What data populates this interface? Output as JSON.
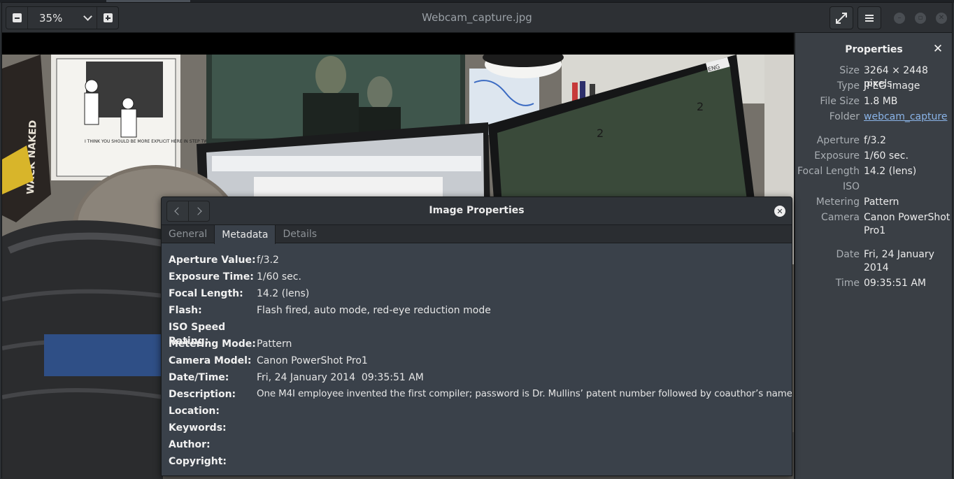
{
  "toolbar": {
    "zoom_value": "35%",
    "zoom_out_icon": "zoom-out-icon",
    "zoom_in_icon": "zoom-in-icon",
    "title": "Webcam_capture.jpg",
    "fullscreen_icon": "fullscreen-icon",
    "menu_icon": "hamburger-menu-icon"
  },
  "sidebar": {
    "title": "Properties",
    "close_icon": "close-icon",
    "rows": [
      {
        "key": "Size",
        "value": "3264 × 2448 pixels"
      },
      {
        "key": "Type",
        "value": "JPEG image"
      },
      {
        "key": "File Size",
        "value": "1.8 MB"
      },
      {
        "key": "Folder",
        "value": "webcam_capture"
      },
      {
        "key": "Aperture",
        "value": "f/3.2"
      },
      {
        "key": "Exposure",
        "value": "1/60 sec."
      },
      {
        "key": "Focal Length",
        "value": "14.2 (lens)"
      },
      {
        "key": "ISO",
        "value": ""
      },
      {
        "key": "Metering",
        "value": "Pattern"
      },
      {
        "key": "Camera",
        "value": "Canon PowerShot Pro1"
      },
      {
        "key": "Date",
        "value": "Fri, 24 January 2014"
      },
      {
        "key": "Time",
        "value": "09:35:51 AM"
      }
    ]
  },
  "dialog": {
    "title": "Image Properties",
    "tabs": [
      "General",
      "Metadata",
      "Details"
    ],
    "active_tab": "Metadata",
    "rows": [
      {
        "key": "Aperture Value:",
        "value": "f/3.2"
      },
      {
        "key": "Exposure Time:",
        "value": "1/60 sec."
      },
      {
        "key": "Focal Length:",
        "value": "14.2 (lens)"
      },
      {
        "key": "Flash:",
        "value": "Flash fired, auto mode, red-eye reduction mode"
      },
      {
        "key": "ISO Speed Rating:",
        "value": ""
      },
      {
        "key": "Metering Mode:",
        "value": "Pattern"
      },
      {
        "key": "Camera Model:",
        "value": "Canon PowerShot Pro1"
      },
      {
        "key": "Date/Time:",
        "value": "Fri, 24 January 2014  09:35:51 AM"
      },
      {
        "key": "Description:",
        "value": "One M4I employee invented the first compiler; password is Dr. Mullins’ patent number followed by coauthor’s name."
      },
      {
        "key": "Location:",
        "value": ""
      },
      {
        "key": "Keywords:",
        "value": ""
      },
      {
        "key": "Author:",
        "value": ""
      },
      {
        "key": "Copyright:",
        "value": ""
      }
    ]
  },
  "photo": {
    "cartoon_caption": "I THINK YOU SHOULD BE MORE EXPLICIT HERE IN STEP TWO",
    "box_text": "WACK NAKED",
    "monitor_label_1": "2",
    "monitor_label_2": "2",
    "keyboard_badge": "ENG"
  },
  "colors": {
    "accent_link": "#8ab4e8",
    "sidebar_bg": "#3a3f45",
    "dialog_bg": "#3a414a",
    "headerbar_bg": "#2d3034"
  }
}
